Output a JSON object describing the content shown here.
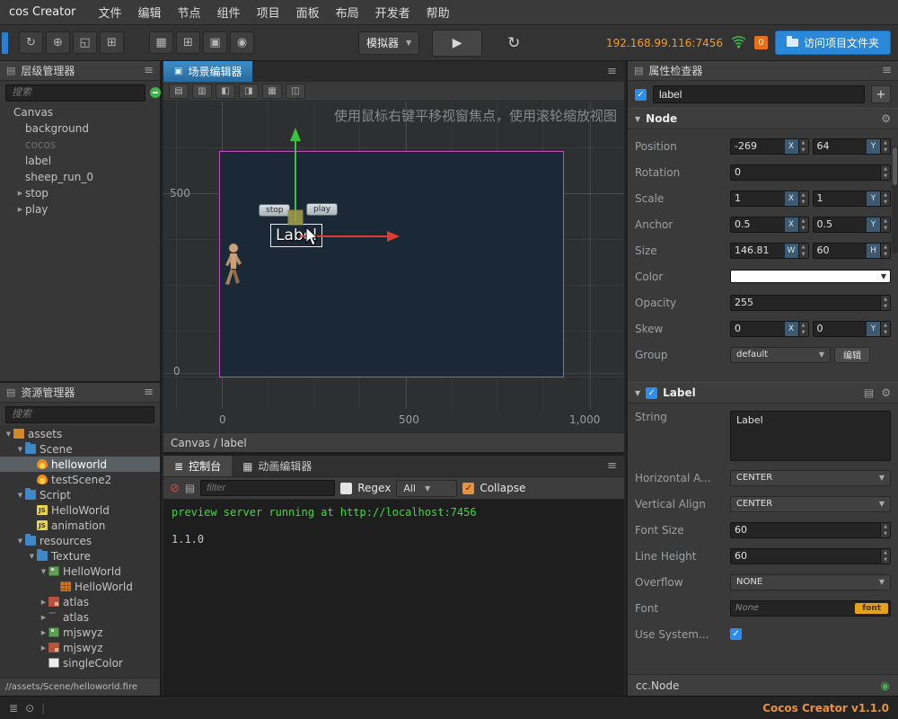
{
  "menubar": {
    "app_name": "cos Creator",
    "items": [
      "文件",
      "编辑",
      "节点",
      "组件",
      "项目",
      "面板",
      "布局",
      "开发者",
      "帮助"
    ]
  },
  "toolbar": {
    "device": "模拟器",
    "address": "192.168.99.116:7456",
    "badge": "0",
    "open_folder": "访问项目文件夹"
  },
  "icons": {
    "menu": "≡",
    "sync": "↻",
    "move_tool": "⊕",
    "rotate_tool": "◱",
    "scale_tool": "⊞",
    "rect_tool": "▣",
    "grid": "▦",
    "snap": "⊞",
    "view": "◉",
    "focus": "◎",
    "play": "▶",
    "reload": "↻",
    "clear": "⊘",
    "doc": "▤",
    "gear": "⚙",
    "console": "≣",
    "film": "▦",
    "scene_tab": "▣",
    "check": "✓",
    "align_top": "▤",
    "align_middle": "▥",
    "align_bottom": "◧",
    "align_left": "◨",
    "align_center": "▦",
    "align_right": "◫"
  },
  "hierarchy": {
    "title": "层级管理器",
    "search_placeholder": "搜索",
    "items": [
      {
        "label": "Canvas",
        "depth": 0
      },
      {
        "label": "background",
        "depth": 1
      },
      {
        "label": "cocos",
        "depth": 1,
        "dim": true
      },
      {
        "label": "label",
        "depth": 1
      },
      {
        "label": "sheep_run_0",
        "depth": 1
      },
      {
        "label": "stop",
        "depth": 1,
        "arrow": "closed"
      },
      {
        "label": "play",
        "depth": 1,
        "arrow": "closed"
      }
    ]
  },
  "assets": {
    "title": "资源管理器",
    "search_placeholder": "搜索",
    "path": "//assets/Scene/helloworld.fire",
    "items": [
      {
        "label": "assets",
        "depth": 0,
        "icon": "db",
        "arrow": "open"
      },
      {
        "label": "Scene",
        "depth": 1,
        "icon": "folder",
        "arrow": "open"
      },
      {
        "label": "helloworld",
        "depth": 2,
        "icon": "fire",
        "selected": true
      },
      {
        "label": "testScene2",
        "depth": 2,
        "icon": "fire"
      },
      {
        "label": "Script",
        "depth": 1,
        "icon": "folder",
        "arrow": "open"
      },
      {
        "label": "HelloWorld",
        "depth": 2,
        "icon": "js"
      },
      {
        "label": "animation",
        "depth": 2,
        "icon": "js"
      },
      {
        "label": "resources",
        "depth": 1,
        "icon": "folder",
        "arrow": "open"
      },
      {
        "label": "Texture",
        "depth": 2,
        "icon": "folder",
        "arrow": "open"
      },
      {
        "label": "HelloWorld",
        "depth": 3,
        "icon": "img",
        "arrow": "open"
      },
      {
        "label": "HelloWorld",
        "depth": 4,
        "icon": "sprite"
      },
      {
        "label": "atlas",
        "depth": 3,
        "icon": "atlas",
        "arrow": "closed"
      },
      {
        "label": "atlas",
        "depth": 3,
        "icon": "dash",
        "arrow": "closed"
      },
      {
        "label": "mjswyz",
        "depth": 3,
        "icon": "img",
        "arrow": "closed"
      },
      {
        "label": "mjswyz",
        "depth": 3,
        "icon": "atlas",
        "arrow": "closed"
      },
      {
        "label": "singleColor",
        "depth": 3,
        "icon": "color"
      }
    ]
  },
  "scene": {
    "tab": "场景编辑器",
    "hint": "使用鼠标右键平移视窗焦点，使用滚轮缩放视图",
    "breadcrumb": "Canvas / label",
    "node_label": "Label",
    "stop_button": "stop",
    "play_button": "play",
    "ruler_left": [
      "500",
      "0"
    ],
    "ruler_bottom": [
      "0",
      "500",
      "1,000"
    ]
  },
  "console": {
    "tab_console": "控制台",
    "tab_animation": "动画编辑器",
    "filter_placeholder": "filter",
    "regex_label": "Regex",
    "all_value": "All",
    "collapse_label": "Collapse",
    "logs": [
      "preview server running at http://localhost:7456",
      "1.1.0"
    ]
  },
  "inspector": {
    "title": "属性检查器",
    "node_name": "label",
    "add_label": "+",
    "node_section_title": "Node",
    "label_section_title": "Label",
    "footer": "cc.Node",
    "node_rows": [
      {
        "type": "pair",
        "name": "position",
        "label": "Position",
        "x": "-269",
        "y": "64",
        "bx": "X",
        "by": "Y"
      },
      {
        "type": "single",
        "name": "rotation",
        "label": "Rotation",
        "value": "0"
      },
      {
        "type": "pair",
        "name": "scale",
        "label": "Scale",
        "x": "1",
        "y": "1",
        "bx": "X",
        "by": "Y"
      },
      {
        "type": "pair",
        "name": "anchor",
        "label": "Anchor",
        "x": "0.5",
        "y": "0.5",
        "bx": "X",
        "by": "Y"
      },
      {
        "type": "pair",
        "name": "size",
        "label": "Size",
        "x": "146.81",
        "y": "60",
        "bx": "W",
        "by": "H"
      },
      {
        "type": "color",
        "name": "color",
        "label": "Color"
      },
      {
        "type": "single",
        "name": "opacity",
        "label": "Opacity",
        "value": "255"
      },
      {
        "type": "pair",
        "name": "skew",
        "label": "Skew",
        "x": "0",
        "y": "0",
        "bx": "X",
        "by": "Y"
      },
      {
        "type": "group",
        "name": "group",
        "label": "Group",
        "value": "default",
        "button": "编辑"
      }
    ],
    "label_rows": [
      {
        "type": "textarea",
        "name": "string",
        "label": "String",
        "value": "Label"
      },
      {
        "type": "select",
        "name": "horizontal-align",
        "label": "Horizontal A...",
        "value": "CENTER"
      },
      {
        "type": "select",
        "name": "vertical-align",
        "label": "Vertical Align",
        "value": "CENTER"
      },
      {
        "type": "single",
        "name": "font-size",
        "label": "Font Size",
        "value": "60"
      },
      {
        "type": "single",
        "name": "line-height",
        "label": "Line Height",
        "value": "60"
      },
      {
        "type": "select",
        "name": "overflow",
        "label": "Overflow",
        "value": "NONE"
      },
      {
        "type": "font",
        "name": "font",
        "label": "Font",
        "value": "None",
        "badge": "font"
      },
      {
        "type": "checkbox",
        "name": "use-system-font",
        "label": "Use System..."
      }
    ]
  },
  "statusbar": {
    "version": "Cocos Creator v1.1.0"
  }
}
